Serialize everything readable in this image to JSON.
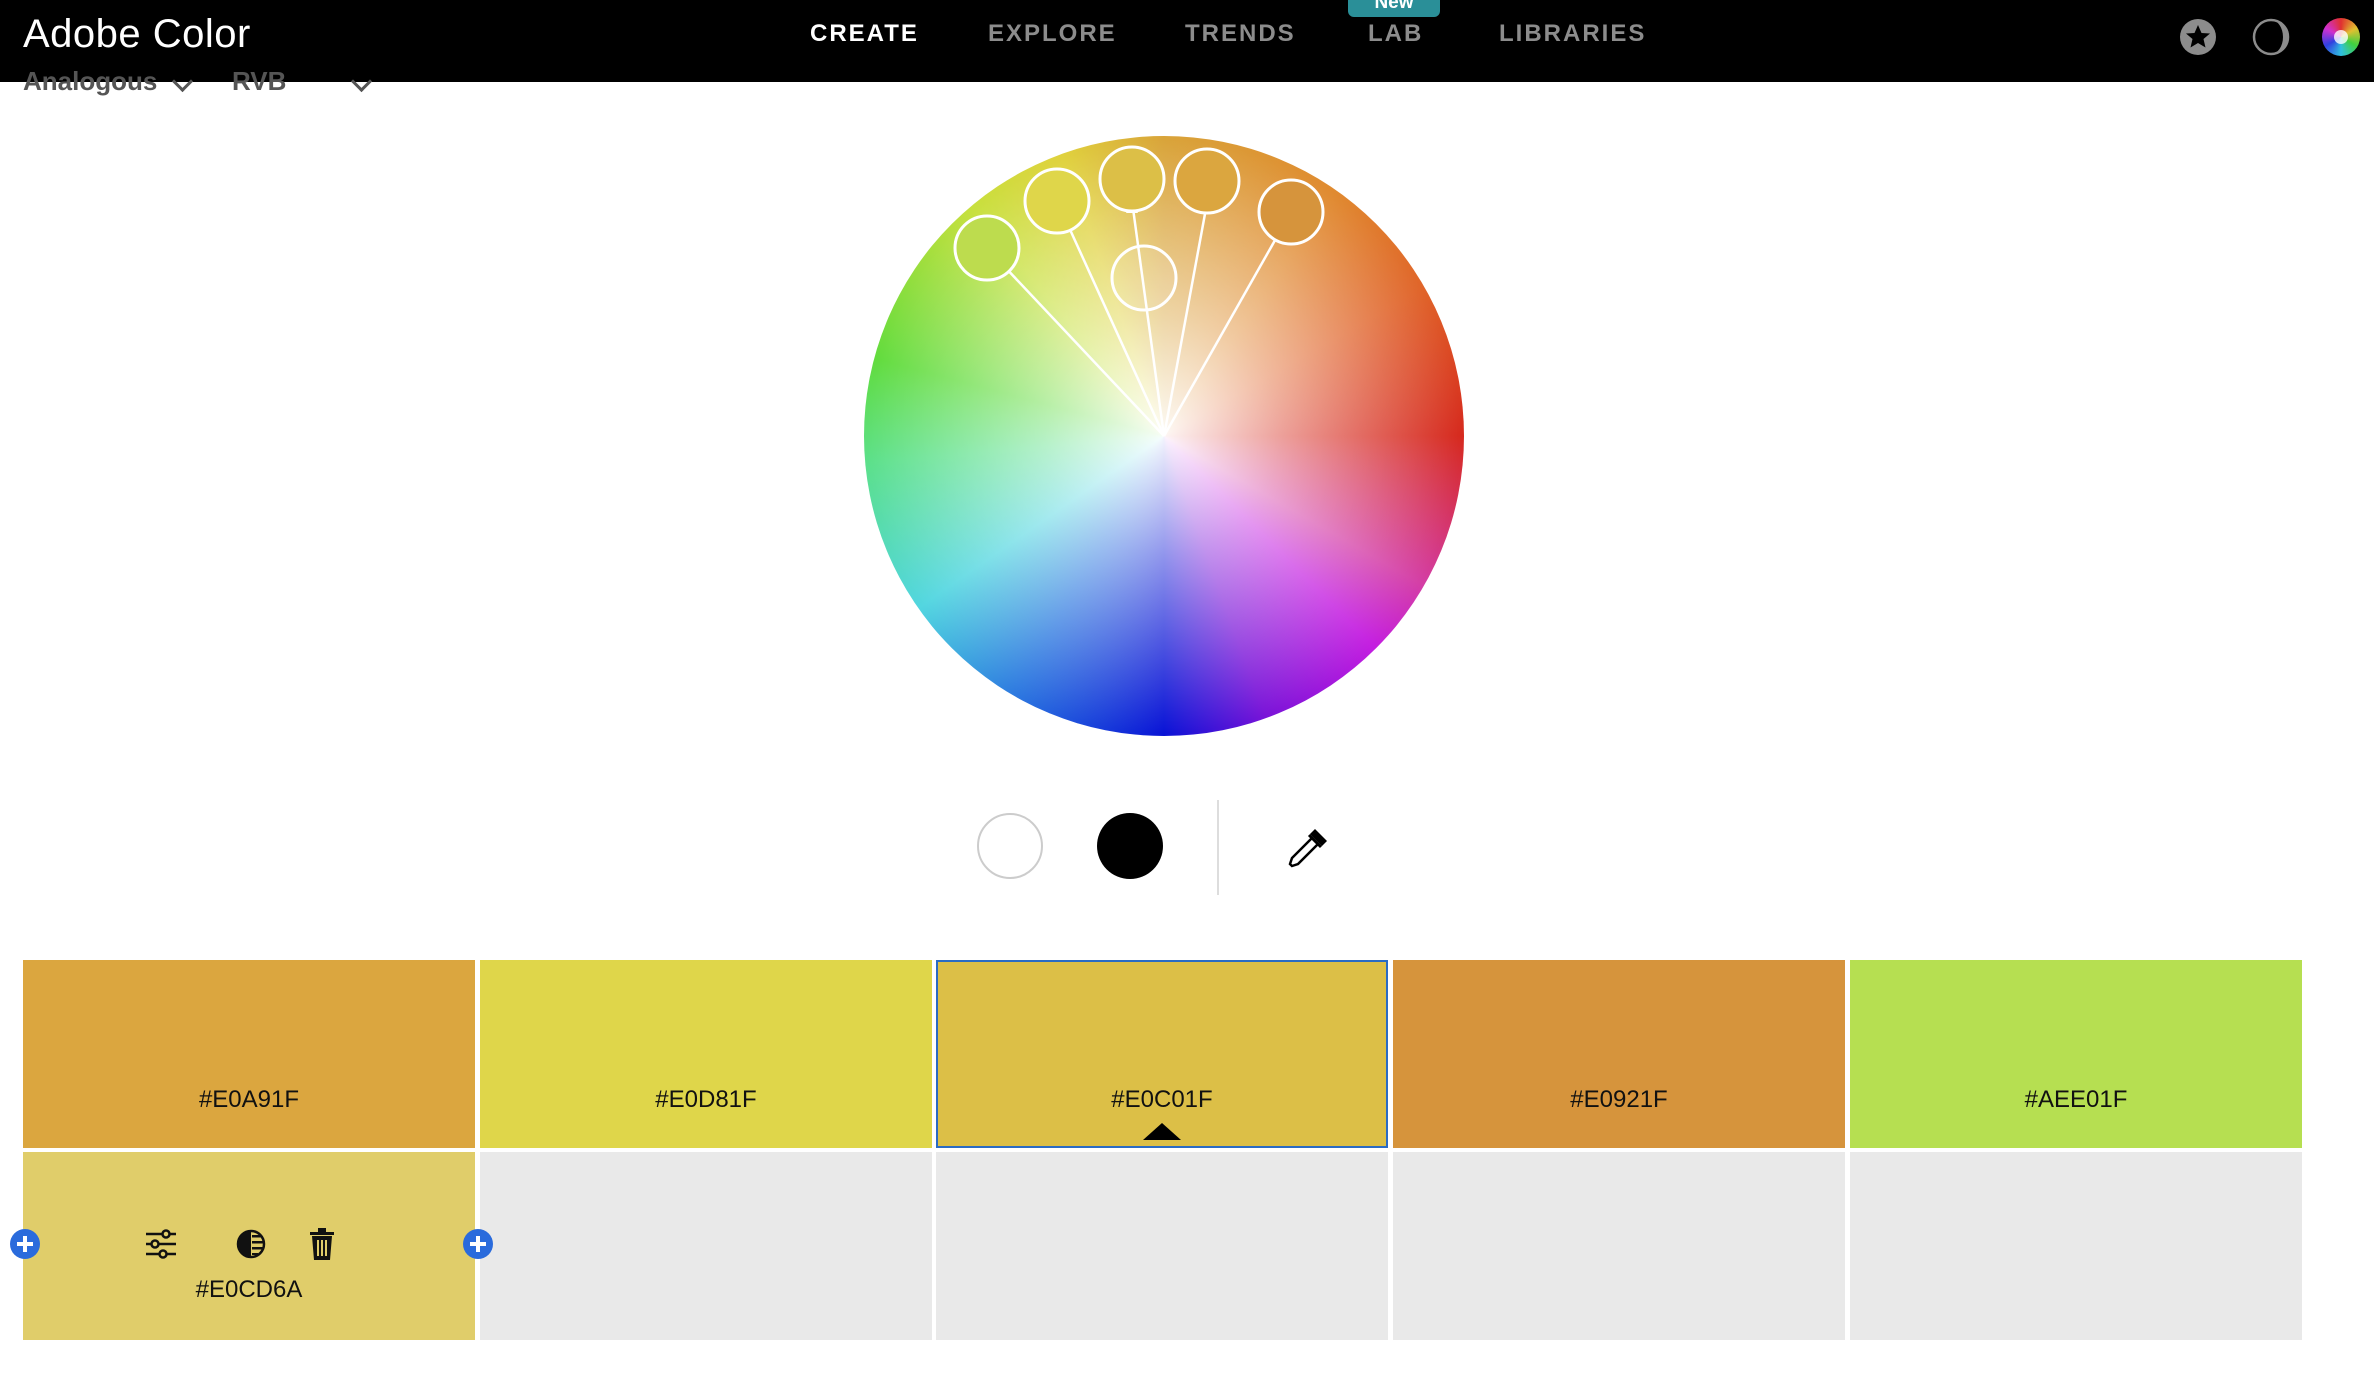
{
  "app": {
    "title": "Adobe Color"
  },
  "nav": {
    "items": [
      {
        "label": "CREATE",
        "active": true
      },
      {
        "label": "EXPLORE",
        "active": false
      },
      {
        "label": "TRENDS",
        "active": false
      },
      {
        "label": "LAB",
        "active": false,
        "badge": "New"
      },
      {
        "label": "LIBRARIES",
        "active": false
      }
    ]
  },
  "header_icons": [
    "star-icon",
    "dark-mode-icon",
    "color-wheel-icon"
  ],
  "controls": {
    "harmony_rule": "Analogous",
    "color_mode": "RVB"
  },
  "wheel": {
    "icons": [
      "white-swatch-icon",
      "black-swatch-icon",
      "eyedropper-icon"
    ]
  },
  "palette": {
    "swatches": [
      {
        "hex": "#E0A91F",
        "color": "#dba63f"
      },
      {
        "hex": "#E0D81F",
        "color": "#dfd64a"
      },
      {
        "hex": "#E0C01F",
        "color": "#dcbf47",
        "selected": true
      },
      {
        "hex": "#E0921F",
        "color": "#d6943c"
      },
      {
        "hex": "#AEE01F",
        "color": "#b6df51"
      }
    ],
    "shade": {
      "hex": "#E0CD6A",
      "color": "#e0cd6a"
    },
    "tools": [
      "sliders-icon",
      "contrast-icon",
      "trash-icon"
    ]
  }
}
